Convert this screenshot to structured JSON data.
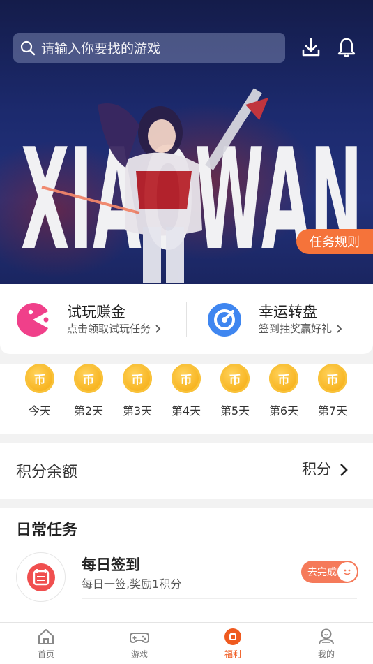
{
  "search": {
    "placeholder": "请输入你要找的游戏"
  },
  "header_icons": [
    "download-icon",
    "bell-icon"
  ],
  "banner": {
    "art_text": "XIAOWAN",
    "task_rules_label": "任务规则"
  },
  "promos": [
    {
      "title": "试玩赚金",
      "subtitle": "点击领取试玩任务",
      "icon": "pacman-icon"
    },
    {
      "title": "幸运转盘",
      "subtitle": "签到抽奖赢好礼",
      "icon": "wheel-icon"
    }
  ],
  "signin": {
    "coin_glyph": "币",
    "days": [
      "今天",
      "第2天",
      "第3天",
      "第4天",
      "第5天",
      "第6天",
      "第7天"
    ]
  },
  "points": {
    "title": "积分余额",
    "unit": "积分"
  },
  "daily_tasks": {
    "title": "日常任务",
    "items": [
      {
        "name": "每日签到",
        "desc": "每日一签,奖励1积分",
        "button": "去完成"
      }
    ]
  },
  "nav": [
    {
      "label": "首页",
      "icon": "home-icon",
      "active": false
    },
    {
      "label": "游戏",
      "icon": "gamepad-icon",
      "active": false
    },
    {
      "label": "福利",
      "icon": "gift-icon",
      "active": true
    },
    {
      "label": "我的",
      "icon": "user-icon",
      "active": false
    }
  ],
  "colors": {
    "accent": "#ef5a1f",
    "banner_bg": "#1c2a6e",
    "coin": "#f7b21d"
  }
}
